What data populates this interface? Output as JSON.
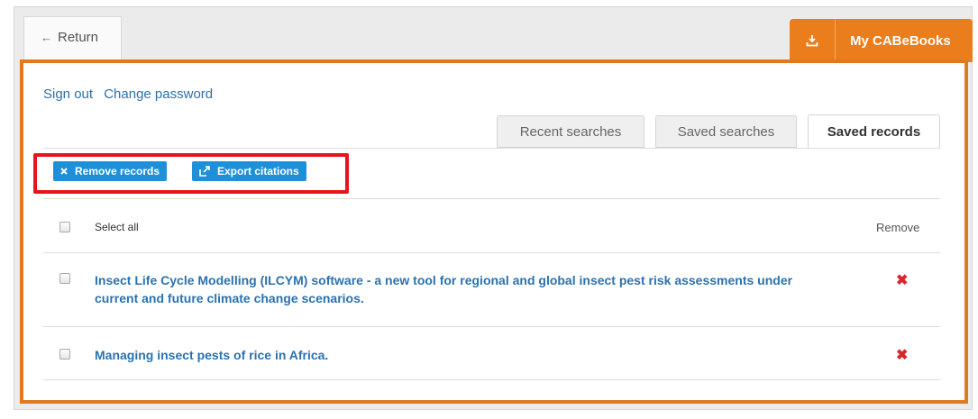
{
  "header": {
    "return_label": "Return",
    "my_books_label": "My CABeBooks"
  },
  "account": {
    "sign_out": "Sign out",
    "change_password": "Change password"
  },
  "tabs": [
    {
      "label": "Recent searches",
      "active": false
    },
    {
      "label": "Saved searches",
      "active": false
    },
    {
      "label": "Saved records",
      "active": true
    }
  ],
  "actions": {
    "remove_records": "Remove records",
    "export_citations": "Export citations"
  },
  "table": {
    "select_all": "Select all",
    "remove_header": "Remove",
    "rows": [
      {
        "title": "Insect Life Cycle Modelling (ILCYM) software - a new tool for regional and global insect pest risk assessments under current and future climate change scenarios."
      },
      {
        "title": "Managing insect pests of rice in Africa."
      }
    ]
  },
  "colors": {
    "accent_orange": "#e07a20",
    "action_blue": "#1e90d9",
    "link_blue": "#2a72b0",
    "remove_red": "#d9262d",
    "highlight_red": "#e8141b"
  }
}
